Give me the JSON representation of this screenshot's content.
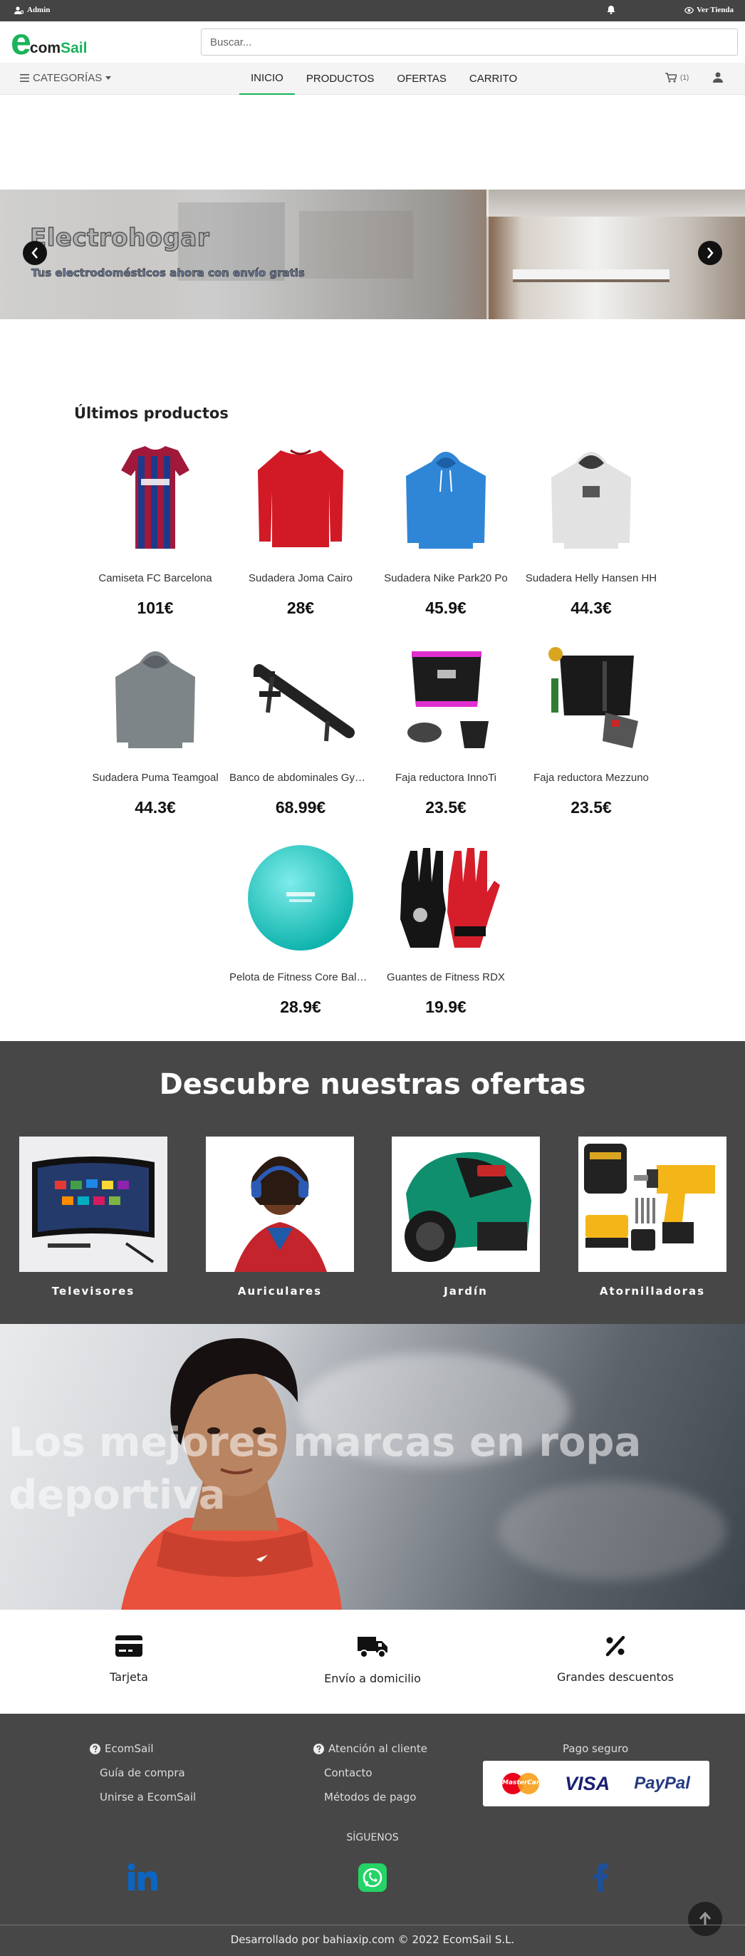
{
  "topbar": {
    "admin_label": "Admin",
    "view_store_label": "Ver Tienda"
  },
  "header": {
    "logo": {
      "letter": "e",
      "name_part1": "com",
      "name_part2": "Sail"
    },
    "search_placeholder": "Buscar..."
  },
  "nav": {
    "categories_label": "CATEGORÍAS",
    "links": [
      "INICIO",
      "PRODUCTOS",
      "OFERTAS",
      "CARRITO"
    ],
    "active": "INICIO",
    "cart_count": "(1)"
  },
  "hero": {
    "title": "Electrohogar",
    "subtitle": "Tus electrodomésticos ahora con envío gratis"
  },
  "latest": {
    "title": "Últimos productos",
    "products": [
      {
        "name": "Camiseta FC Barcelona",
        "price": "101€"
      },
      {
        "name": "Sudadera Joma Cairo",
        "price": "28€"
      },
      {
        "name": "Sudadera Nike Park20 Po",
        "price": "45.9€"
      },
      {
        "name": "Sudadera Helly Hansen HH",
        "price": "44.3€"
      },
      {
        "name": "Sudadera Puma Teamgoal",
        "price": "44.3€"
      },
      {
        "name": "Banco de abdominales Gymnastic",
        "price": "68.99€"
      },
      {
        "name": "Faja reductora InnoTi",
        "price": "23.5€"
      },
      {
        "name": "Faja reductora Mezzuno",
        "price": "23.5€"
      },
      {
        "name": "Pelota de Fitness Core Balance",
        "price": "28.9€"
      },
      {
        "name": "Guantes de Fitness RDX",
        "price": "19.9€"
      }
    ]
  },
  "offers": {
    "title": "Descubre nuestras ofertas",
    "items": [
      "Televisores",
      "Auriculares",
      "Jardín",
      "Atornilladoras"
    ]
  },
  "sport_banner": {
    "title": "Los mejores marcas en ropa deportiva"
  },
  "features": [
    "Tarjeta",
    "Envío a domicilio",
    "Grandes descuentos"
  ],
  "footer": {
    "col1": {
      "title": "EcomSail",
      "links": [
        "Guía de compra",
        "Unirse a EcomSail"
      ]
    },
    "col2": {
      "title": "Atención al cliente",
      "links": [
        "Contacto",
        "Métodos de pago"
      ]
    },
    "col3": {
      "title": "Pago seguro",
      "cards": [
        "MasterCard",
        "VISA",
        "PayPal"
      ]
    },
    "follow_label": "SÍGUENOS",
    "copyright": "Desarrollado por bahiaxip.com © 2022 EcomSail S.L."
  },
  "colors": {
    "brand_green": "#19b35a",
    "dark_band": "#474747",
    "linkedin": "#0a66c2",
    "whatsapp": "#25d366",
    "facebook": "#1f4f96"
  }
}
